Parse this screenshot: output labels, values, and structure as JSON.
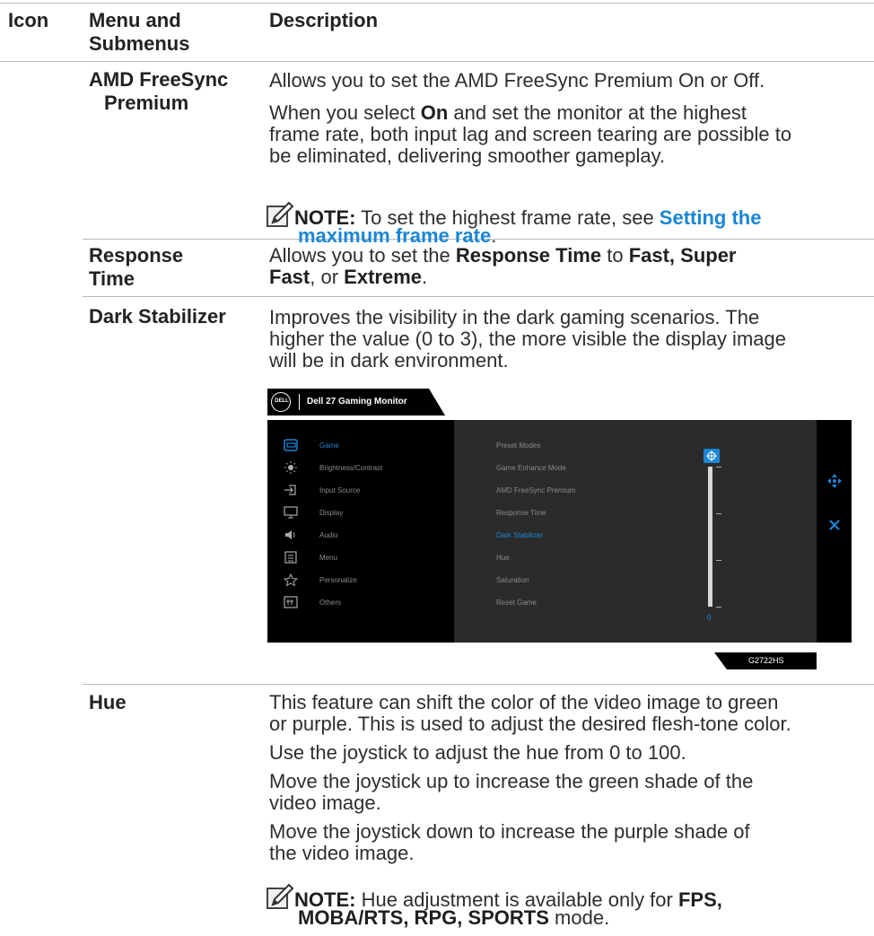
{
  "header": {
    "icon": "Icon",
    "menu_line1": "Menu and",
    "menu_line2": "Submenus",
    "description": "Description"
  },
  "rows": {
    "freesync": {
      "menu_line1": "AMD FreeSync",
      "menu_line2": "Premium",
      "p1": "Allows you to set the  AMD FreeSync Premium On or Off.",
      "p2_pre": "When you select ",
      "p2_bold": "On",
      "p2_l1_rest": " and set the monitor at the highest",
      "p2_l2": "frame rate, both input lag and screen tearing are possible to",
      "p2_l3": "be eliminated, delivering smoother gameplay.",
      "note_label": "NOTE:",
      "note_text": " To set the highest frame rate, see ",
      "note_link1": "Setting the",
      "note_link2": "maximum frame rate",
      "note_end": "."
    },
    "response": {
      "menu_line1": "Response",
      "menu_line2": "Time",
      "l1_a": "Allows you to set the ",
      "l1_b": "Response Time",
      "l1_c": " to ",
      "l1_d": "Fast, Super",
      "l2_a": "Fast",
      "l2_b": ", or ",
      "l2_c": "Extreme",
      "l2_d": "."
    },
    "dark": {
      "menu": "Dark Stabilizer",
      "l1": "Improves the visibility in the dark gaming scenarios. The",
      "l2": "higher the value (0 to 3), the more visible the display image",
      "l3": "will be in dark environment."
    },
    "hue": {
      "menu": "Hue",
      "p1_l1": "This feature can shift the color of the video image to green",
      "p1_l2": "or purple. This is used to adjust the desired flesh-tone color.",
      "p2": "Use the joystick to adjust the hue from 0 to 100.",
      "p3_l1": "Move the joystick up to increase the green shade of the",
      "p3_l2": "video image.",
      "p4_l1": "Move the joystick down to increase the purple shade of",
      "p4_l2": "the video image.",
      "note_label": "NOTE:",
      "note_text": " Hue adjustment is available only for ",
      "note_b1": "FPS,",
      "note_b2": "MOBA/RTS, RPG, SPORTS",
      "note_end": " mode."
    }
  },
  "osd": {
    "brand": "DELL",
    "title": "Dell 27 Gaming Monitor",
    "menu_items": [
      "Game",
      "Brightness/Contrast",
      "Input Source",
      "Display",
      "Audio",
      "Menu",
      "Personalize",
      "Others"
    ],
    "submenu_items": [
      "Preset Modes",
      "Game Enhance Mode",
      "AMD FreeSync Premium",
      "Response Time",
      "Dark Stabilizer",
      "Hue",
      "Saturation",
      "Reset Game"
    ],
    "active_submenu": "Dark Stabilizer",
    "slider_value": "0",
    "model": "G2722HS",
    "accent": "#1a86d4"
  }
}
